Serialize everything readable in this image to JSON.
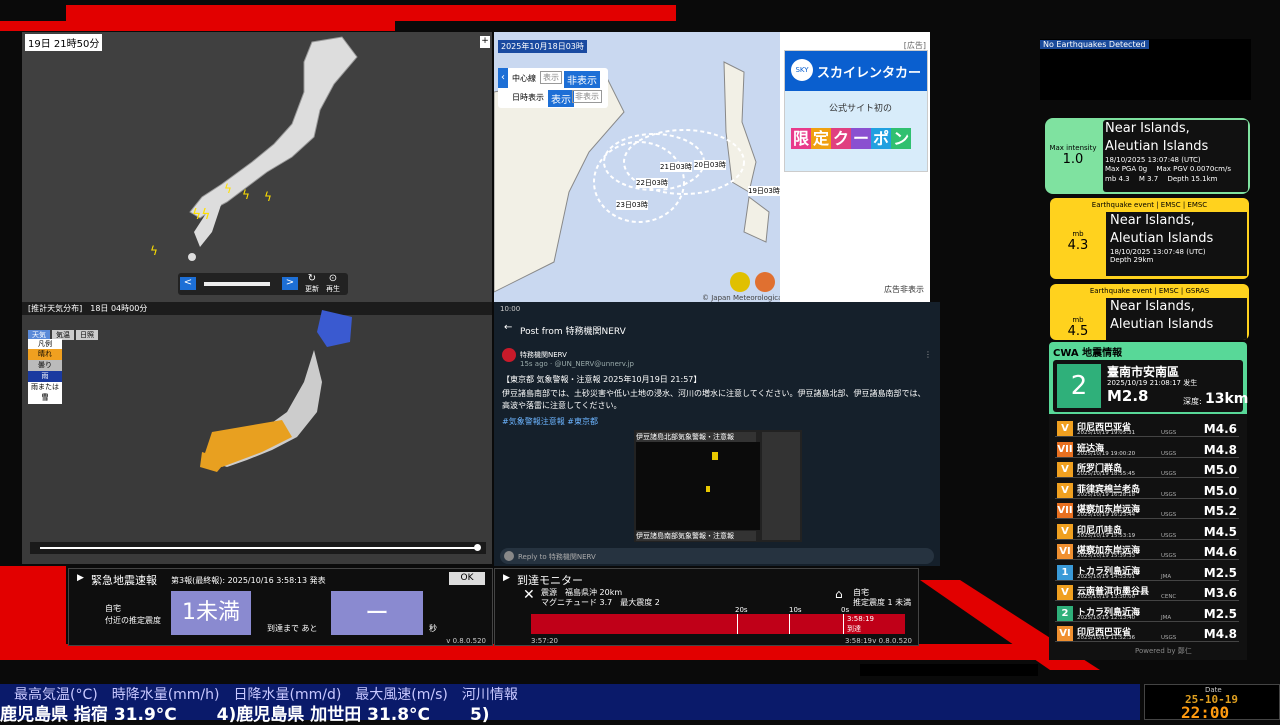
{
  "top_banner": {},
  "weather_map": {
    "title": "19日 21時50分",
    "update": "更新",
    "play": "再生",
    "prev": "<",
    "next": ">"
  },
  "typhoon_map": {
    "title": "2025年10月18日03時",
    "ad_label": "[広告]",
    "hide_ad": "広告非表示",
    "center_line_label": "中心線",
    "time_label": "日時表示",
    "show": "表示",
    "hide": "非表示",
    "copyright": "© Japan Meteorological Agency",
    "labels": [
      "21日03時",
      "20日03時",
      "22日03時",
      "19日03時",
      "23日03時"
    ],
    "ad": {
      "brand": "スカイレンタカー",
      "sub": "公式サイト初の",
      "coupon": [
        "限",
        "定",
        "ク",
        "ー",
        "ポ",
        "ン"
      ]
    }
  },
  "forecast_map": {
    "title": "[推計天気分布]　18日 04時00分",
    "tabs": [
      "天気",
      "気温",
      "日照"
    ],
    "legend_title": "凡例",
    "legend": [
      "晴れ",
      "曇り",
      "雨",
      "雨または雪",
      "雪"
    ]
  },
  "tweet": {
    "time": "10:00",
    "header": "Post from 特務機関NERV",
    "user": "特務機関NERV",
    "handle": "15s ago · @UN_NERV@unnerv.jp",
    "body_1": "【東京都 気象警報・注意報 2025年10月19日 21:57】",
    "body_2": "伊豆諸島南部では、土砂災害や低い土地の浸水、河川の増水に注意してください。伊豆諸島北部、伊豆諸島南部では、高波や落雷に注意してください。",
    "tags": "#気象警報注意報 #東京都",
    "img_caption_top": "伊豆諸島北部気象警報・注意報",
    "img_caption_bottom": "伊豆諸島南部気象警報・注意報",
    "reply": "Reply to 特務機関NERV"
  },
  "eew": {
    "title": "緊急地震速報",
    "report": "第3報(最終報): 2025/10/16 3:58:13 発表",
    "ok": "OK",
    "home_label_1": "自宅",
    "home_label_2": "付近の推定震度",
    "intensity": "1未満",
    "arrival_label": "到達まで あと",
    "arrival_value": "ー",
    "unit": "秒",
    "version": "v 0.8.0.520"
  },
  "arrival": {
    "title": "到達モニター",
    "epi_label": "震源",
    "epi": "福島県沖 20km",
    "mag": "マグニチュード 3.7　最大震度 2",
    "home": "自宅",
    "home_int": "推定震度 1 未満",
    "ticks": [
      "20s",
      "10s",
      "0s"
    ],
    "time_now": "3:58:19",
    "status": "到達",
    "t_start": "3:57:20",
    "t_end": "3:58:19",
    "version": "v 0.8.0.520"
  },
  "quake_monitor": {
    "status": "No Earthquakes Detected"
  },
  "emsc": [
    {
      "header": "",
      "scale_label": "Max intensity",
      "scale_value": "1.0",
      "place": "Near Islands,\nAleutian Islands",
      "time": "18/10/2025 13:07:48 (UTC)",
      "detail_1": "Max PGA 0g　 Max PGV 0.0070cm/s",
      "detail_2": "mb 4.3　 M 3.7　 Depth 15.1km"
    },
    {
      "header": "Earthquake event | EMSC | EMSC",
      "scale_label": "mb",
      "scale_value": "4.3",
      "place": "Near Islands,\nAleutian Islands",
      "time": "18/10/2025 13:07:48 (UTC)",
      "detail_1": "Depth 29km"
    },
    {
      "header": "Earthquake event | EMSC | GSRAS",
      "scale_label": "mb",
      "scale_value": "4.5",
      "place": "Near Islands,\nAleutian Islands"
    }
  ],
  "cwa": {
    "title": "CWA 地震情報",
    "latest": {
      "intensity": "2",
      "place": "臺南市安南區",
      "time": "2025/10/19 21:08:17 发生",
      "mag": "M2.8",
      "depth_label": "深度:",
      "depth": "13km"
    },
    "rows": [
      {
        "int": "V",
        "color": "#f0a020",
        "name": "印尼西巴亚省",
        "date": "2025/10/19 19:05:31",
        "src": "USGS",
        "mag": "M4.6"
      },
      {
        "int": "VII",
        "color": "#e87020",
        "name": "班达海",
        "date": "2025/10/19 19:00:20",
        "src": "USGS",
        "mag": "M4.8"
      },
      {
        "int": "V",
        "color": "#f0a020",
        "name": "所罗门群岛",
        "date": "2025/10/19 18:55:45",
        "src": "USGS",
        "mag": "M5.0"
      },
      {
        "int": "V",
        "color": "#f0a020",
        "name": "菲律宾棉兰老岛",
        "date": "2025/10/19 16:28:18",
        "src": "USGS",
        "mag": "M5.0"
      },
      {
        "int": "VII",
        "color": "#e87020",
        "name": "堪察加东岸远海",
        "date": "2025/10/19 16:23:44",
        "src": "USGS",
        "mag": "M5.2"
      },
      {
        "int": "V",
        "color": "#f0a020",
        "name": "印尼爪哇岛",
        "date": "2025/10/19 15:53:19",
        "src": "USGS",
        "mag": "M4.5"
      },
      {
        "int": "VI",
        "color": "#f09030",
        "name": "堪察加东岸远海",
        "date": "2025/10/19 15:39:33",
        "src": "USGS",
        "mag": "M4.6"
      },
      {
        "int": "1",
        "color": "#3a9ad8",
        "name": "トカラ列島近海",
        "date": "2025/10/19 14:33:01",
        "src": "JMA",
        "mag": "M2.5"
      },
      {
        "int": "V",
        "color": "#f0a020",
        "name": "云南普洱市墨谷县",
        "date": "2025/10/19 13:30:00",
        "src": "CENC",
        "mag": "M3.6"
      },
      {
        "int": "2",
        "color": "#2fb07a",
        "name": "トカラ列島近海",
        "date": "2025/10/19 12:13:40",
        "src": "JMA",
        "mag": "M2.5"
      },
      {
        "int": "VI",
        "color": "#f09030",
        "name": "印尼西巴亚省",
        "date": "2025/10/19 11:52:36",
        "src": "USGS",
        "mag": "M4.8"
      }
    ],
    "footer": "Powered by 鄭仁"
  },
  "ticker": {
    "categories": "最高気温(°C)　時降水量(mm/h)　日降水量(mm/d)　最大風速(m/s)　河川情報",
    "items": "鹿児島県 指宿 31.9°C　　 4)鹿児島県 加世田 31.8°C　　 5)"
  },
  "clock": {
    "date_label": "Date",
    "date": "25-10-19",
    "time": "22:00"
  }
}
